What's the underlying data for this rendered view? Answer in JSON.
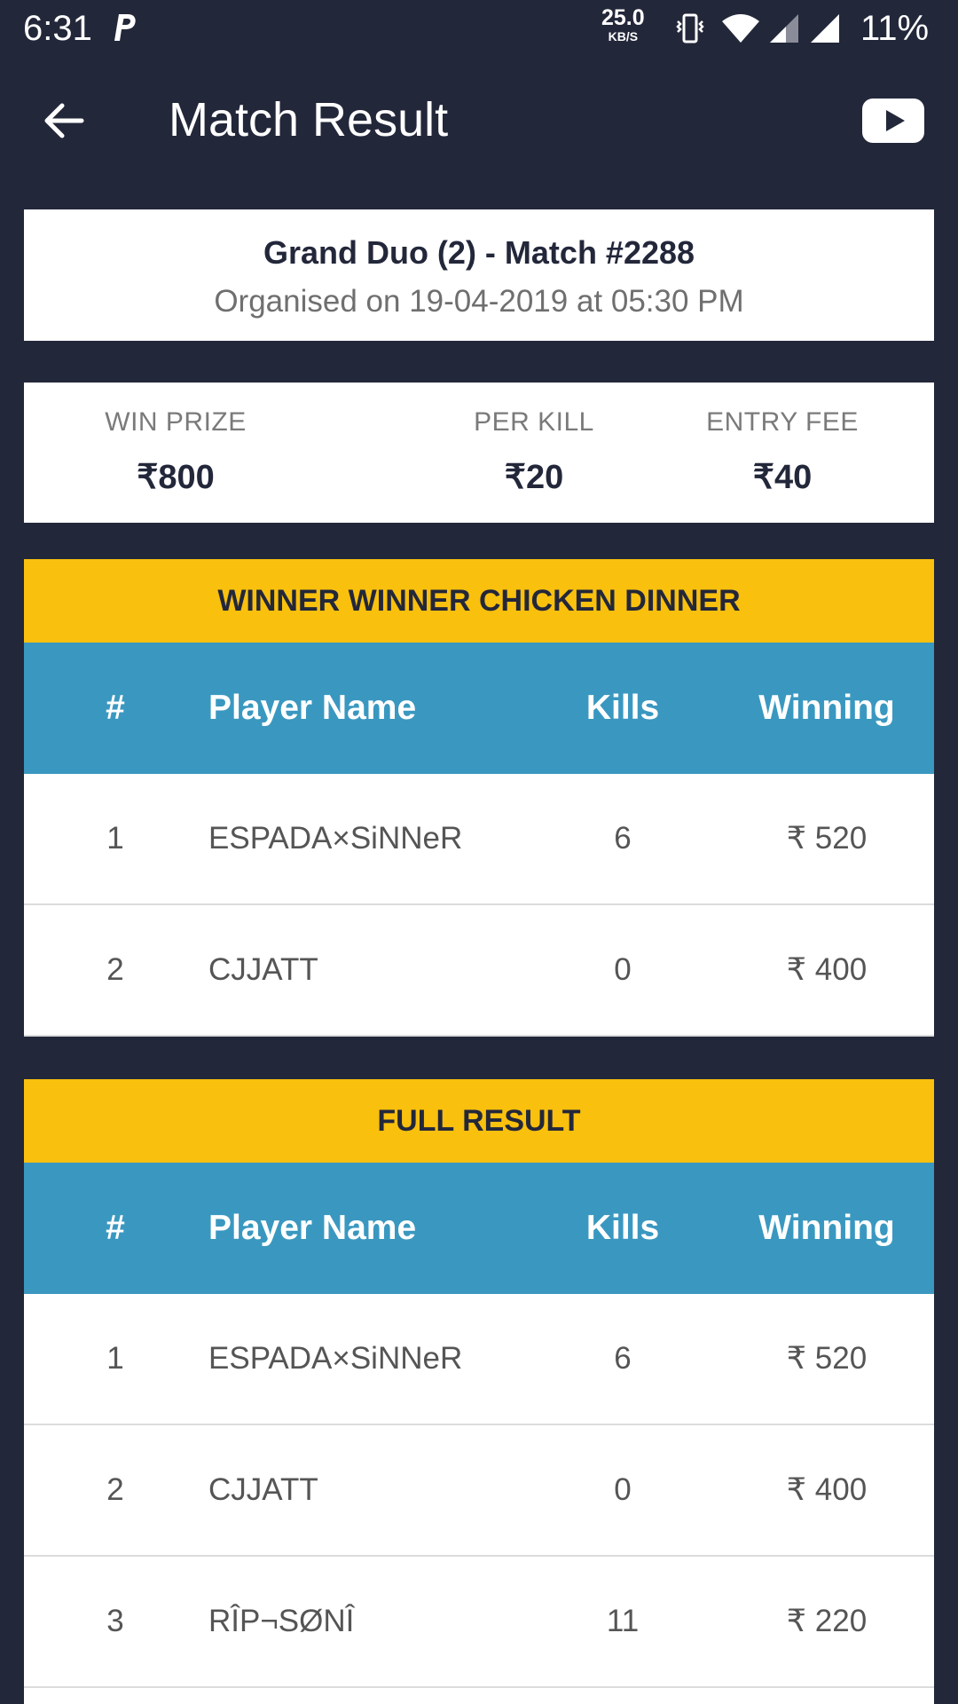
{
  "status_bar": {
    "time": "6:31",
    "net_speed": "25.0",
    "net_unit": "KB/S",
    "battery": "11%"
  },
  "app_bar": {
    "title": "Match Result",
    "back_icon": "arrow-left-icon",
    "video_icon": "youtube-icon"
  },
  "match": {
    "title": "Grand Duo (2) - Match #2288",
    "subtitle": "Organised on 19-04-2019 at 05:30 PM"
  },
  "prizes": [
    {
      "label": "WIN PRIZE",
      "value": "₹800"
    },
    {
      "label": "PER KILL",
      "value": "₹20"
    },
    {
      "label": "ENTRY FEE",
      "value": "₹40"
    }
  ],
  "table_headers": {
    "rank": "#",
    "name": "Player Name",
    "kills": "Kills",
    "winning": "Winning"
  },
  "winners": {
    "title": "WINNER WINNER CHICKEN DINNER",
    "rows": [
      {
        "rank": "1",
        "name": "ESPADA×SiNNeR",
        "kills": "6",
        "winning": "₹ 520"
      },
      {
        "rank": "2",
        "name": "CJJATT",
        "kills": "0",
        "winning": "₹ 400"
      }
    ]
  },
  "full_result": {
    "title": "FULL RESULT",
    "rows": [
      {
        "rank": "1",
        "name": "ESPADA×SiNNeR",
        "kills": "6",
        "winning": "₹ 520"
      },
      {
        "rank": "2",
        "name": "CJJATT",
        "kills": "0",
        "winning": "₹ 400"
      },
      {
        "rank": "3",
        "name": "RÎP¬SØNÎ",
        "kills": "11",
        "winning": "₹ 220"
      }
    ]
  },
  "colors": {
    "background": "#23273a",
    "banner": "#f9c00e",
    "table_header": "#3a98c0"
  }
}
